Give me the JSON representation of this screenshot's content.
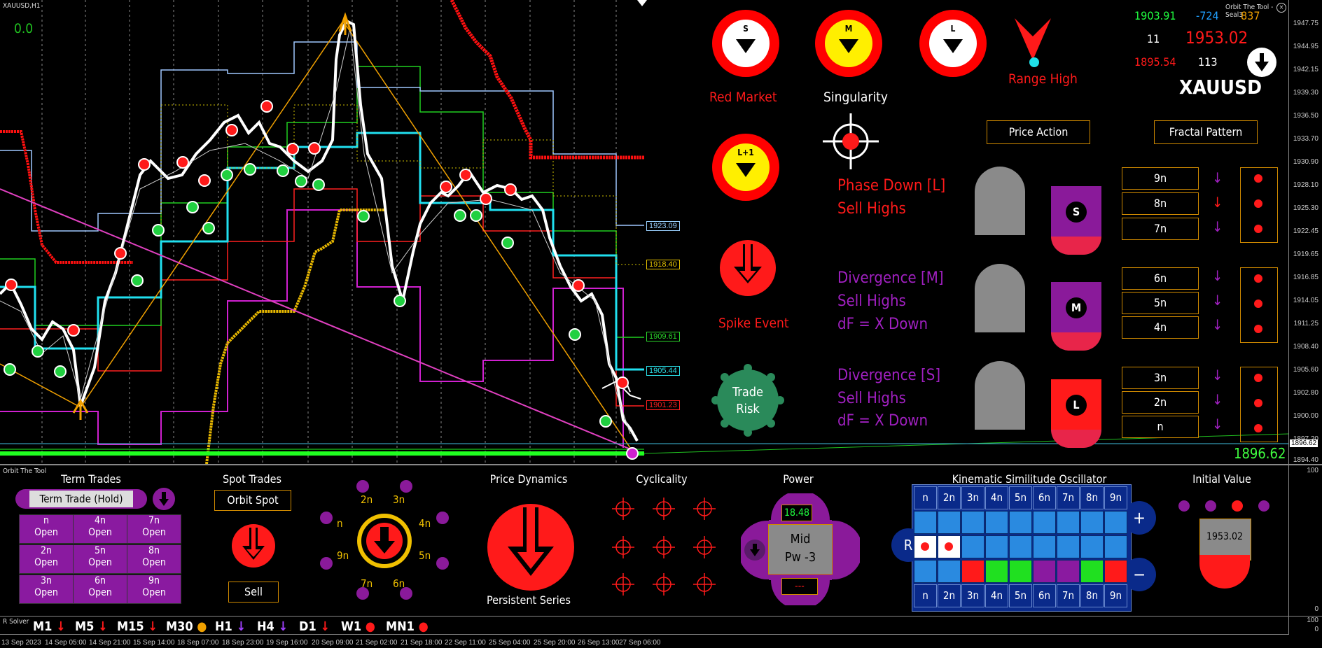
{
  "chart": {
    "symbol_period": "XAUUSD,H1",
    "indicator_value": "0.0",
    "tool_label": "Orbit The Tool - Seal3",
    "current_price": "1896.62",
    "current_price_tag": "1896.62",
    "price_axis": [
      "1947.75",
      "1944.95",
      "1942.15",
      "1939.30",
      "1936.50",
      "1933.70",
      "1930.90",
      "1928.10",
      "1925.30",
      "1922.45",
      "1919.65",
      "1916.85",
      "1914.05",
      "1911.25",
      "1908.40",
      "1905.60",
      "1902.80",
      "1900.00",
      "1897.20",
      "1894.40"
    ],
    "price_tags": [
      {
        "value": "1923.09",
        "color": "#9ad0ff"
      },
      {
        "value": "1918.40",
        "color": "#e8c400"
      },
      {
        "value": "1909.61",
        "color": "#2ad82a"
      },
      {
        "value": "1905.44",
        "color": "#2ae0e8"
      },
      {
        "value": "1901.23",
        "color": "#ff2020"
      }
    ],
    "time_axis": [
      "13 Sep 2023",
      "14 Sep 05:00",
      "14 Sep 21:00",
      "15 Sep 14:00",
      "18 Sep 07:00",
      "18 Sep 23:00",
      "19 Sep 16:00",
      "20 Sep 09:00",
      "21 Sep 02:00",
      "21 Sep 18:00",
      "22 Sep 11:00",
      "25 Sep 04:00",
      "25 Sep 20:00",
      "26 Sep 13:00",
      "27 Sep 06:00"
    ],
    "sub_window_label": "Orbit The Tool",
    "sub_axis_top": "100",
    "sub_axis_bottom": "0",
    "solver_label": "R Solver",
    "solver_axis_top": "100",
    "solver_axis_bottom": "0"
  },
  "header_stats": {
    "v1": "1903.91",
    "v2": "-724",
    "v3": "837",
    "v4": "11",
    "v5": "1953.02",
    "v6": "1895.54",
    "v7": "113",
    "symbol": "XAUUSD"
  },
  "clocks": [
    {
      "letter": "S",
      "ring": "#ff0000"
    },
    {
      "letter": "M",
      "ring": "#ff0000"
    },
    {
      "letter": "L",
      "ring": "#ff0000"
    },
    {
      "letter": "L+1",
      "ring": "#ff0000"
    }
  ],
  "labels": {
    "red_market": "Red Market",
    "singularity": "Singularity",
    "range_high": "Range High",
    "spike_event": "Spike Event",
    "trade_risk_1": "Trade",
    "trade_risk_2": "Risk",
    "price_action": "Price Action",
    "fractal_pattern": "Fractal Pattern"
  },
  "phases": [
    {
      "line1": "Phase Down [L]",
      "line2": "Sell Highs",
      "line3": "",
      "color": "#ff1a1a",
      "shield": "S"
    },
    {
      "line1": "Divergence [M]",
      "line2": "Sell Highs",
      "line3": "dF = X Down",
      "color": "#a020c0",
      "shield": "M"
    },
    {
      "line1": "Divergence [S]",
      "line2": "Sell Highs",
      "line3": "dF = X Down",
      "color": "#a020c0",
      "shield": "L"
    }
  ],
  "fractal_levels": [
    "9n",
    "8n",
    "7n",
    "6n",
    "5n",
    "4n",
    "3n",
    "2n",
    "n"
  ],
  "bottom": {
    "term_trades": "Term Trades",
    "term_trade_hold": "Term Trade (Hold)",
    "term_cells": [
      {
        "top": "n",
        "bottom": "Open"
      },
      {
        "top": "4n",
        "bottom": "Open"
      },
      {
        "top": "7n",
        "bottom": "Open"
      },
      {
        "top": "2n",
        "bottom": "Open"
      },
      {
        "top": "5n",
        "bottom": "Open"
      },
      {
        "top": "8n",
        "bottom": "Open"
      },
      {
        "top": "3n",
        "bottom": "Open"
      },
      {
        "top": "6n",
        "bottom": "Open"
      },
      {
        "top": "9n",
        "bottom": "Open"
      }
    ],
    "spot_trades": "Spot Trades",
    "orbit_spot": "Orbit Spot",
    "sell": "Sell",
    "orbit_labels": [
      "2n",
      "3n",
      "n",
      "4n",
      "9n",
      "5n",
      "7n",
      "6n"
    ],
    "price_dynamics": "Price Dynamics",
    "persistent_series": "Persistent Series",
    "cyclicality": "Cyclicality",
    "power": "Power",
    "power_value": "18.48",
    "power_state_1": "Mid",
    "power_state_2": "Pw -3",
    "power_dash": "---",
    "kso_title": "Kinematic Similitude Oscillator",
    "kso_headers": [
      "n",
      "2n",
      "3n",
      "4n",
      "5n",
      "6n",
      "7n",
      "8n",
      "9n"
    ],
    "kso_r": "R",
    "kso_plus": "+",
    "kso_minus": "−",
    "initial_value": "Initial Value",
    "initial_value_num": "1953.02"
  },
  "timeframes": [
    {
      "label": "M1",
      "mark": "down",
      "color": "#ff1a1a"
    },
    {
      "label": "M5",
      "mark": "down",
      "color": "#ff1a1a"
    },
    {
      "label": "M15",
      "mark": "down",
      "color": "#ff1a1a"
    },
    {
      "label": "M30",
      "mark": "dot",
      "color": "#f0a000"
    },
    {
      "label": "H1",
      "mark": "down",
      "color": "#a040ff"
    },
    {
      "label": "H4",
      "mark": "down",
      "color": "#a040ff"
    },
    {
      "label": "D1",
      "mark": "down",
      "color": "#ff1a1a"
    },
    {
      "label": "W1",
      "mark": "dot",
      "color": "#ff1a1a"
    },
    {
      "label": "MN1",
      "mark": "dot",
      "color": "#ff1a1a"
    }
  ]
}
